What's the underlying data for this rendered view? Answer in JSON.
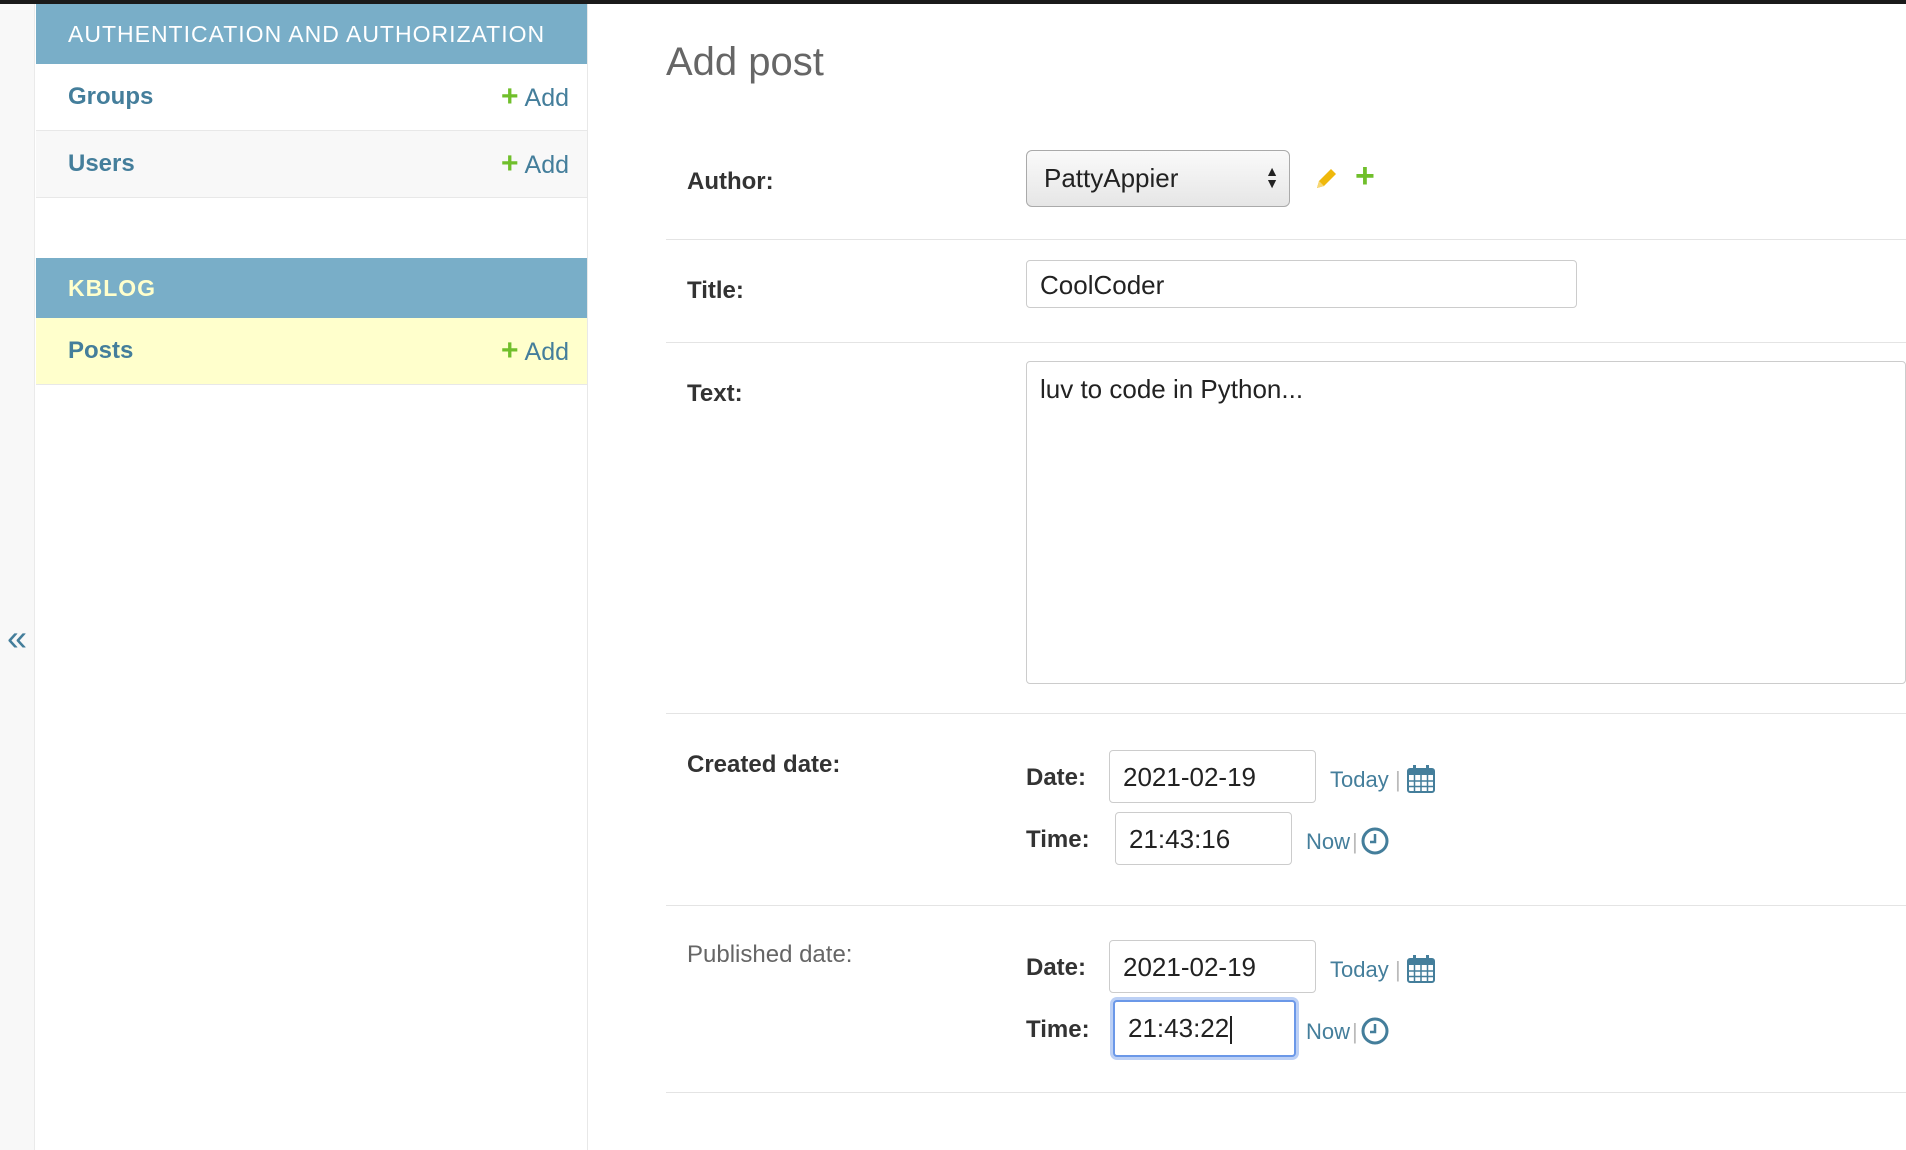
{
  "colors": {
    "module_header": "#79aec8",
    "link": "#447e9b",
    "add_plus": "#70bf2b",
    "active_row": "#ffffcc",
    "edit_pencil": "#efb80b"
  },
  "sidebar": {
    "modules": [
      {
        "caption": "AUTHENTICATION AND AUTHORIZATION",
        "models": [
          {
            "name": "Groups",
            "add_label": "Add"
          },
          {
            "name": "Users",
            "add_label": "Add"
          }
        ]
      },
      {
        "caption": "KBLOG",
        "models": [
          {
            "name": "Posts",
            "add_label": "Add"
          }
        ]
      }
    ],
    "collapse_glyph": "«"
  },
  "page": {
    "title": "Add post"
  },
  "form": {
    "author": {
      "label": "Author:",
      "selected": "PattyAppier"
    },
    "title": {
      "label": "Title:",
      "value": "CoolCoder"
    },
    "text": {
      "label": "Text:",
      "value": "luv to code in Python..."
    },
    "created_date": {
      "label": "Created date:",
      "date_label": "Date:",
      "date_value": "2021-02-19",
      "today_label": "Today",
      "time_label": "Time:",
      "time_value": "21:43:16",
      "now_label": "Now"
    },
    "published_date": {
      "label": "Published date:",
      "date_label": "Date:",
      "date_value": "2021-02-19",
      "today_label": "Today",
      "time_label": "Time:",
      "time_value": "21:43:22",
      "now_label": "Now"
    }
  }
}
